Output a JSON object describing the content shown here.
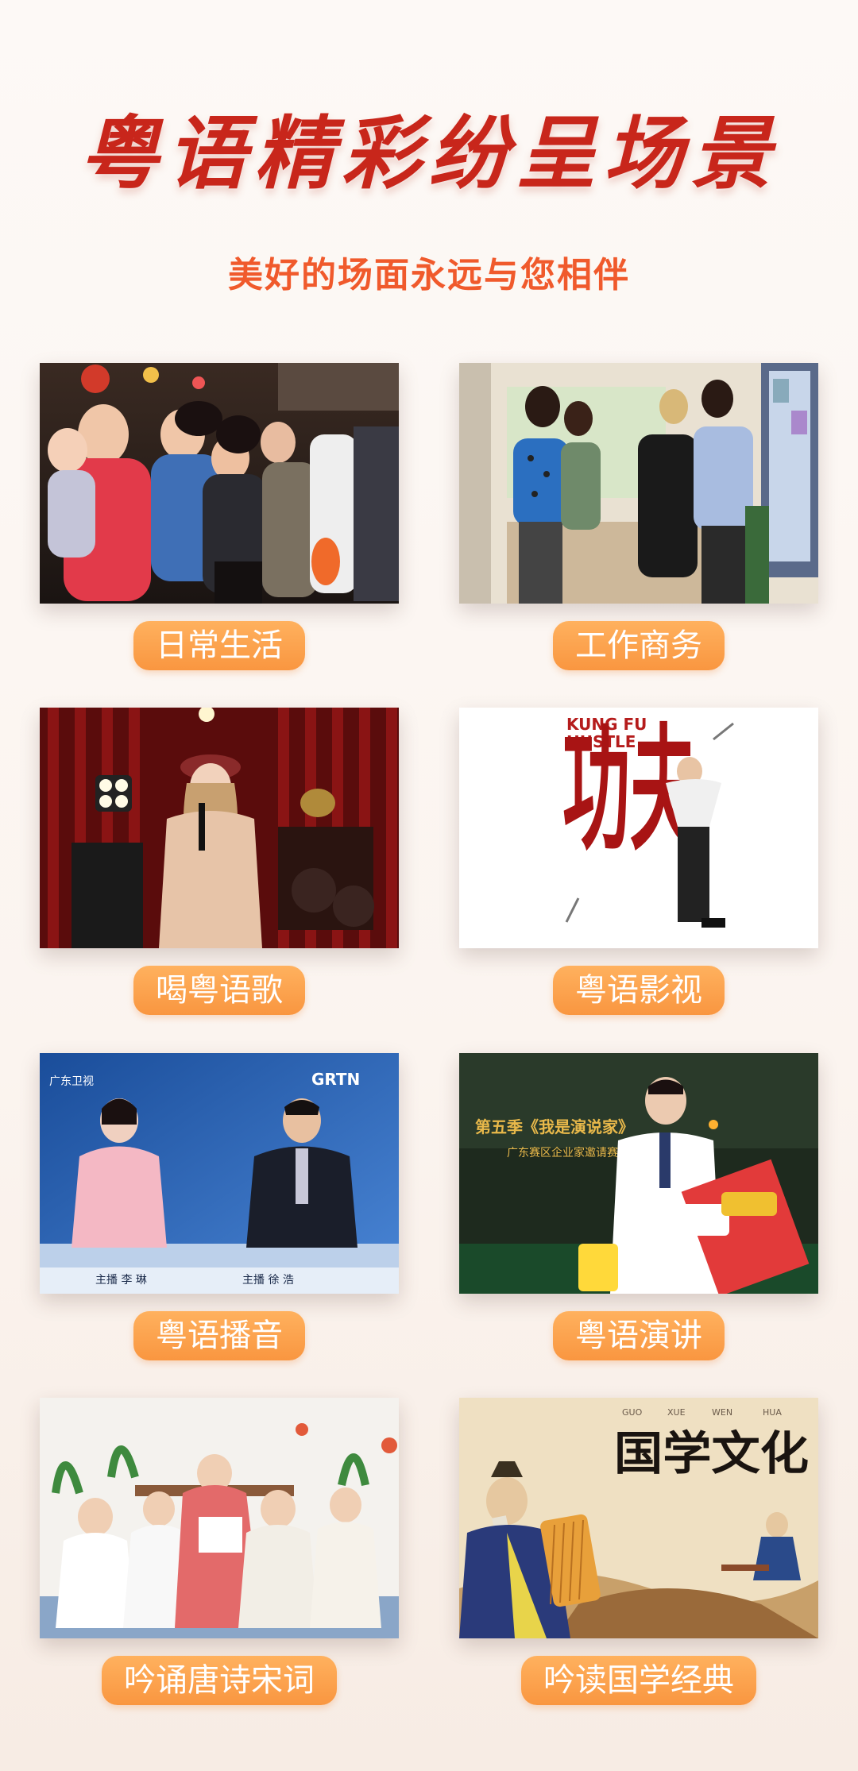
{
  "header": {
    "title": "粤语精彩纷呈场景",
    "subtitle": "美好的场面永远与您相伴"
  },
  "cards": [
    {
      "label": "日常生活",
      "image": "crowd-selfie-photo"
    },
    {
      "label": "工作商务",
      "image": "business-meeting-photo"
    },
    {
      "label": "喝粤语歌",
      "image": "singer-stage-photo"
    },
    {
      "label": "粤语影视",
      "image": "kung-fu-hustle-poster"
    },
    {
      "label": "粤语播音",
      "image": "news-anchors-photo",
      "overlay": {
        "station": "广东卫视",
        "brand": "GRTN",
        "anchor_left": "主播 李 琳",
        "anchor_right": "主播 徐 浩"
      }
    },
    {
      "label": "粤语演讲",
      "image": "speech-interview-photo",
      "overlay": {
        "banner1": "第五季《我是演说家》",
        "banner2": "广东赛区企业家邀请赛"
      }
    },
    {
      "label": "吟诵唐诗宋词",
      "image": "children-poetry-photo"
    },
    {
      "label": "吟读国学经典",
      "image": "guoxue-culture-illustration",
      "overlay": {
        "pinyin": [
          "GUO",
          "XUE",
          "WEN",
          "HUA"
        ],
        "title": "国学文化"
      }
    }
  ],
  "poster": {
    "title_en_1": "KUNG FU",
    "title_en_2": "HUSTLE",
    "title_cn": "功夫"
  },
  "colors": {
    "title": "#c8261b",
    "subtitle": "#f05a2c",
    "pill_top": "#ffb15e",
    "pill_bottom": "#f99640"
  }
}
